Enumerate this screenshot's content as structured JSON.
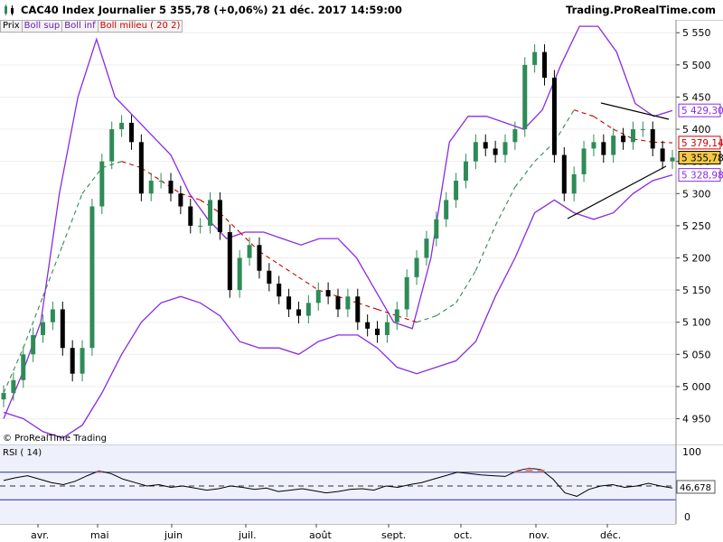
{
  "header": {
    "title": "CAC40 Index   Journalier   5 355,78 (+0,06%)   21 déc. 2017 14:59:00",
    "source": "Trading.ProRealTime.com"
  },
  "legend": {
    "items": [
      "Prix",
      "Boll sup",
      "Boll inf",
      "Boll milieu ( 20 2)"
    ],
    "colors": [
      "#000000",
      "#8a2be2",
      "#8a2be2",
      "#cc0000"
    ]
  },
  "watermark": "© ProRealTime Trading",
  "rsi": {
    "label": "RSI ( 14)",
    "current": "46,678",
    "levels": [
      70,
      50,
      30
    ],
    "axis_labels": [
      "100",
      "0"
    ]
  },
  "colors": {
    "up": "#2e8b57",
    "down": "#000000",
    "boll_band": "#8a2be2",
    "boll_mid_down": "#cc0000",
    "boll_mid_up": "#2e8b57",
    "rsi_line": "#000000",
    "rsi_box": "#2b2b9b",
    "current_box": "#f5c842"
  },
  "chart_data": [
    {
      "type": "line",
      "title": "CAC40 Index",
      "ylim": [
        4910,
        5570
      ],
      "yticks": [
        "5 550",
        "5 500",
        "5 450",
        "5 400",
        "5 350",
        "5 300",
        "5 250",
        "5 200",
        "5 150",
        "5 100",
        "5 050",
        "5 000",
        "4 950"
      ],
      "months": [
        "avr.",
        "mai",
        "juin",
        "juil.",
        "août",
        "sept.",
        "oct.",
        "nov.",
        "déc."
      ],
      "price_labels": [
        {
          "text": "5 429,30",
          "value": 5429.3,
          "series": "Boll sup"
        },
        {
          "text": "5 379,14",
          "value": 5379.14,
          "series": "Boll milieu"
        },
        {
          "text": "5 355,78",
          "value": 5355.78,
          "series": "Prix"
        },
        {
          "text": "5 328,98",
          "value": 5328.98,
          "series": "Boll inf"
        }
      ],
      "series": [
        {
          "name": "Prix",
          "values": [
            4990,
            5010,
            5050,
            5080,
            5100,
            5120,
            5060,
            5020,
            5060,
            5280,
            5350,
            5400,
            5410,
            5380,
            5300,
            5320,
            5320,
            5300,
            5280,
            5250,
            5250,
            5290,
            5240,
            5150,
            5200,
            5220,
            5180,
            5160,
            5140,
            5120,
            5110,
            5130,
            5150,
            5140,
            5120,
            5140,
            5100,
            5090,
            5080,
            5100,
            5120,
            5170,
            5200,
            5230,
            5260,
            5290,
            5320,
            5350,
            5380,
            5370,
            5360,
            5380,
            5400,
            5500,
            5520,
            5480,
            5360,
            5300,
            5330,
            5370,
            5380,
            5360,
            5390,
            5380,
            5400,
            5400,
            5370,
            5350,
            5356
          ]
        },
        {
          "name": "Boll sup",
          "values": [
            4950,
            5020,
            5100,
            5300,
            5450,
            5540,
            5450,
            5420,
            5390,
            5360,
            5300,
            5260,
            5230,
            5240,
            5240,
            5230,
            5220,
            5230,
            5230,
            5200,
            5150,
            5100,
            5090,
            5200,
            5380,
            5420,
            5420,
            5410,
            5400,
            5430,
            5500,
            5560,
            5560,
            5520,
            5440,
            5420,
            5429
          ]
        },
        {
          "name": "Boll inf",
          "values": [
            4960,
            4950,
            4930,
            4920,
            4940,
            4990,
            5050,
            5100,
            5130,
            5140,
            5130,
            5110,
            5070,
            5060,
            5060,
            5050,
            5070,
            5080,
            5080,
            5060,
            5030,
            5020,
            5030,
            5040,
            5070,
            5140,
            5200,
            5270,
            5290,
            5270,
            5260,
            5270,
            5300,
            5320,
            5329
          ]
        },
        {
          "name": "Boll milieu",
          "values": [
            4990,
            5060,
            5140,
            5220,
            5300,
            5340,
            5350,
            5340,
            5320,
            5300,
            5290,
            5270,
            5240,
            5210,
            5190,
            5170,
            5150,
            5140,
            5130,
            5120,
            5110,
            5100,
            5110,
            5130,
            5180,
            5250,
            5310,
            5350,
            5380,
            5430,
            5420,
            5400,
            5385,
            5380,
            5379
          ]
        }
      ]
    },
    {
      "type": "line",
      "title": "RSI ( 14)",
      "ylim": [
        0,
        100
      ],
      "series": [
        {
          "name": "RSI ( 14)",
          "values": [
            58,
            62,
            65,
            60,
            55,
            52,
            57,
            65,
            72,
            68,
            60,
            55,
            50,
            52,
            48,
            50,
            47,
            44,
            46,
            50,
            48,
            45,
            47,
            42,
            44,
            46,
            43,
            40,
            42,
            45,
            46,
            44,
            50,
            48,
            52,
            55,
            60,
            65,
            70,
            68,
            66,
            65,
            64,
            72,
            76,
            74,
            60,
            40,
            35,
            45,
            50,
            52,
            48,
            50,
            54,
            50,
            47
          ]
        }
      ]
    }
  ]
}
